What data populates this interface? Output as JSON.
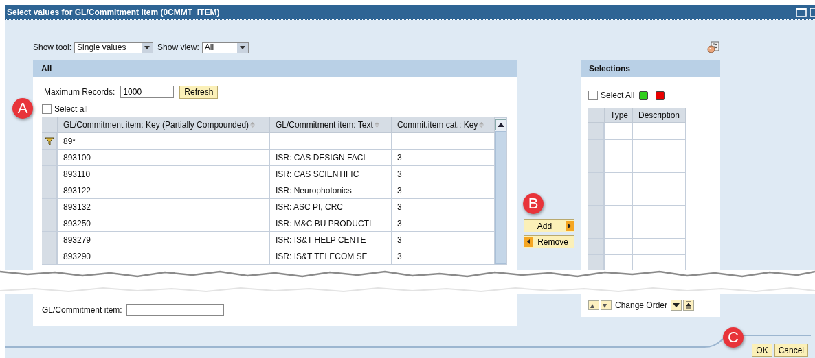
{
  "window": {
    "title": "Select values for GL/Commitment item (0CMMT_ITEM)"
  },
  "toolbar": {
    "show_tool_label": "Show tool:",
    "show_tool_value": "Single values",
    "show_view_label": "Show view:",
    "show_view_value": "All"
  },
  "left_panel": {
    "title": "All",
    "max_records_label": "Maximum Records:",
    "max_records_value": "1000",
    "refresh_button": "Refresh",
    "select_all": {
      "label": "Select all",
      "checked": false
    },
    "table": {
      "columns": [
        "GL/Commitment item: Key (Partially Compounded)",
        "GL/Commitment item: Text",
        "Commit.item cat.: Key"
      ],
      "filter": {
        "key": "89*"
      },
      "rows": [
        [
          "893100",
          "ISR: CAS DESIGN FACI",
          "3"
        ],
        [
          "893110",
          "ISR: CAS SCIENTIFIC",
          "3"
        ],
        [
          "893122",
          "ISR: Neurophotonics",
          "3"
        ],
        [
          "893132",
          "ISR: ASC PI, CRC",
          "3"
        ],
        [
          "893250",
          "ISR: M&C BU PRODUCTI",
          "3"
        ],
        [
          "893279",
          "ISR: IS&T HELP CENTE",
          "3"
        ],
        [
          "893290",
          "ISR: IS&T TELECOM SE",
          "3"
        ]
      ]
    },
    "field_label": "GL/Commitment item:"
  },
  "add_button": "Add",
  "remove_button": "Remove",
  "right_panel": {
    "title": "Selections",
    "select_all": {
      "label": "Select All",
      "checked": false
    },
    "columns": [
      "Type",
      "Description"
    ],
    "change_order_label": "Change Order"
  },
  "buttons": [
    "OK",
    "Cancel"
  ],
  "callouts": [
    "A",
    "B",
    "C"
  ]
}
